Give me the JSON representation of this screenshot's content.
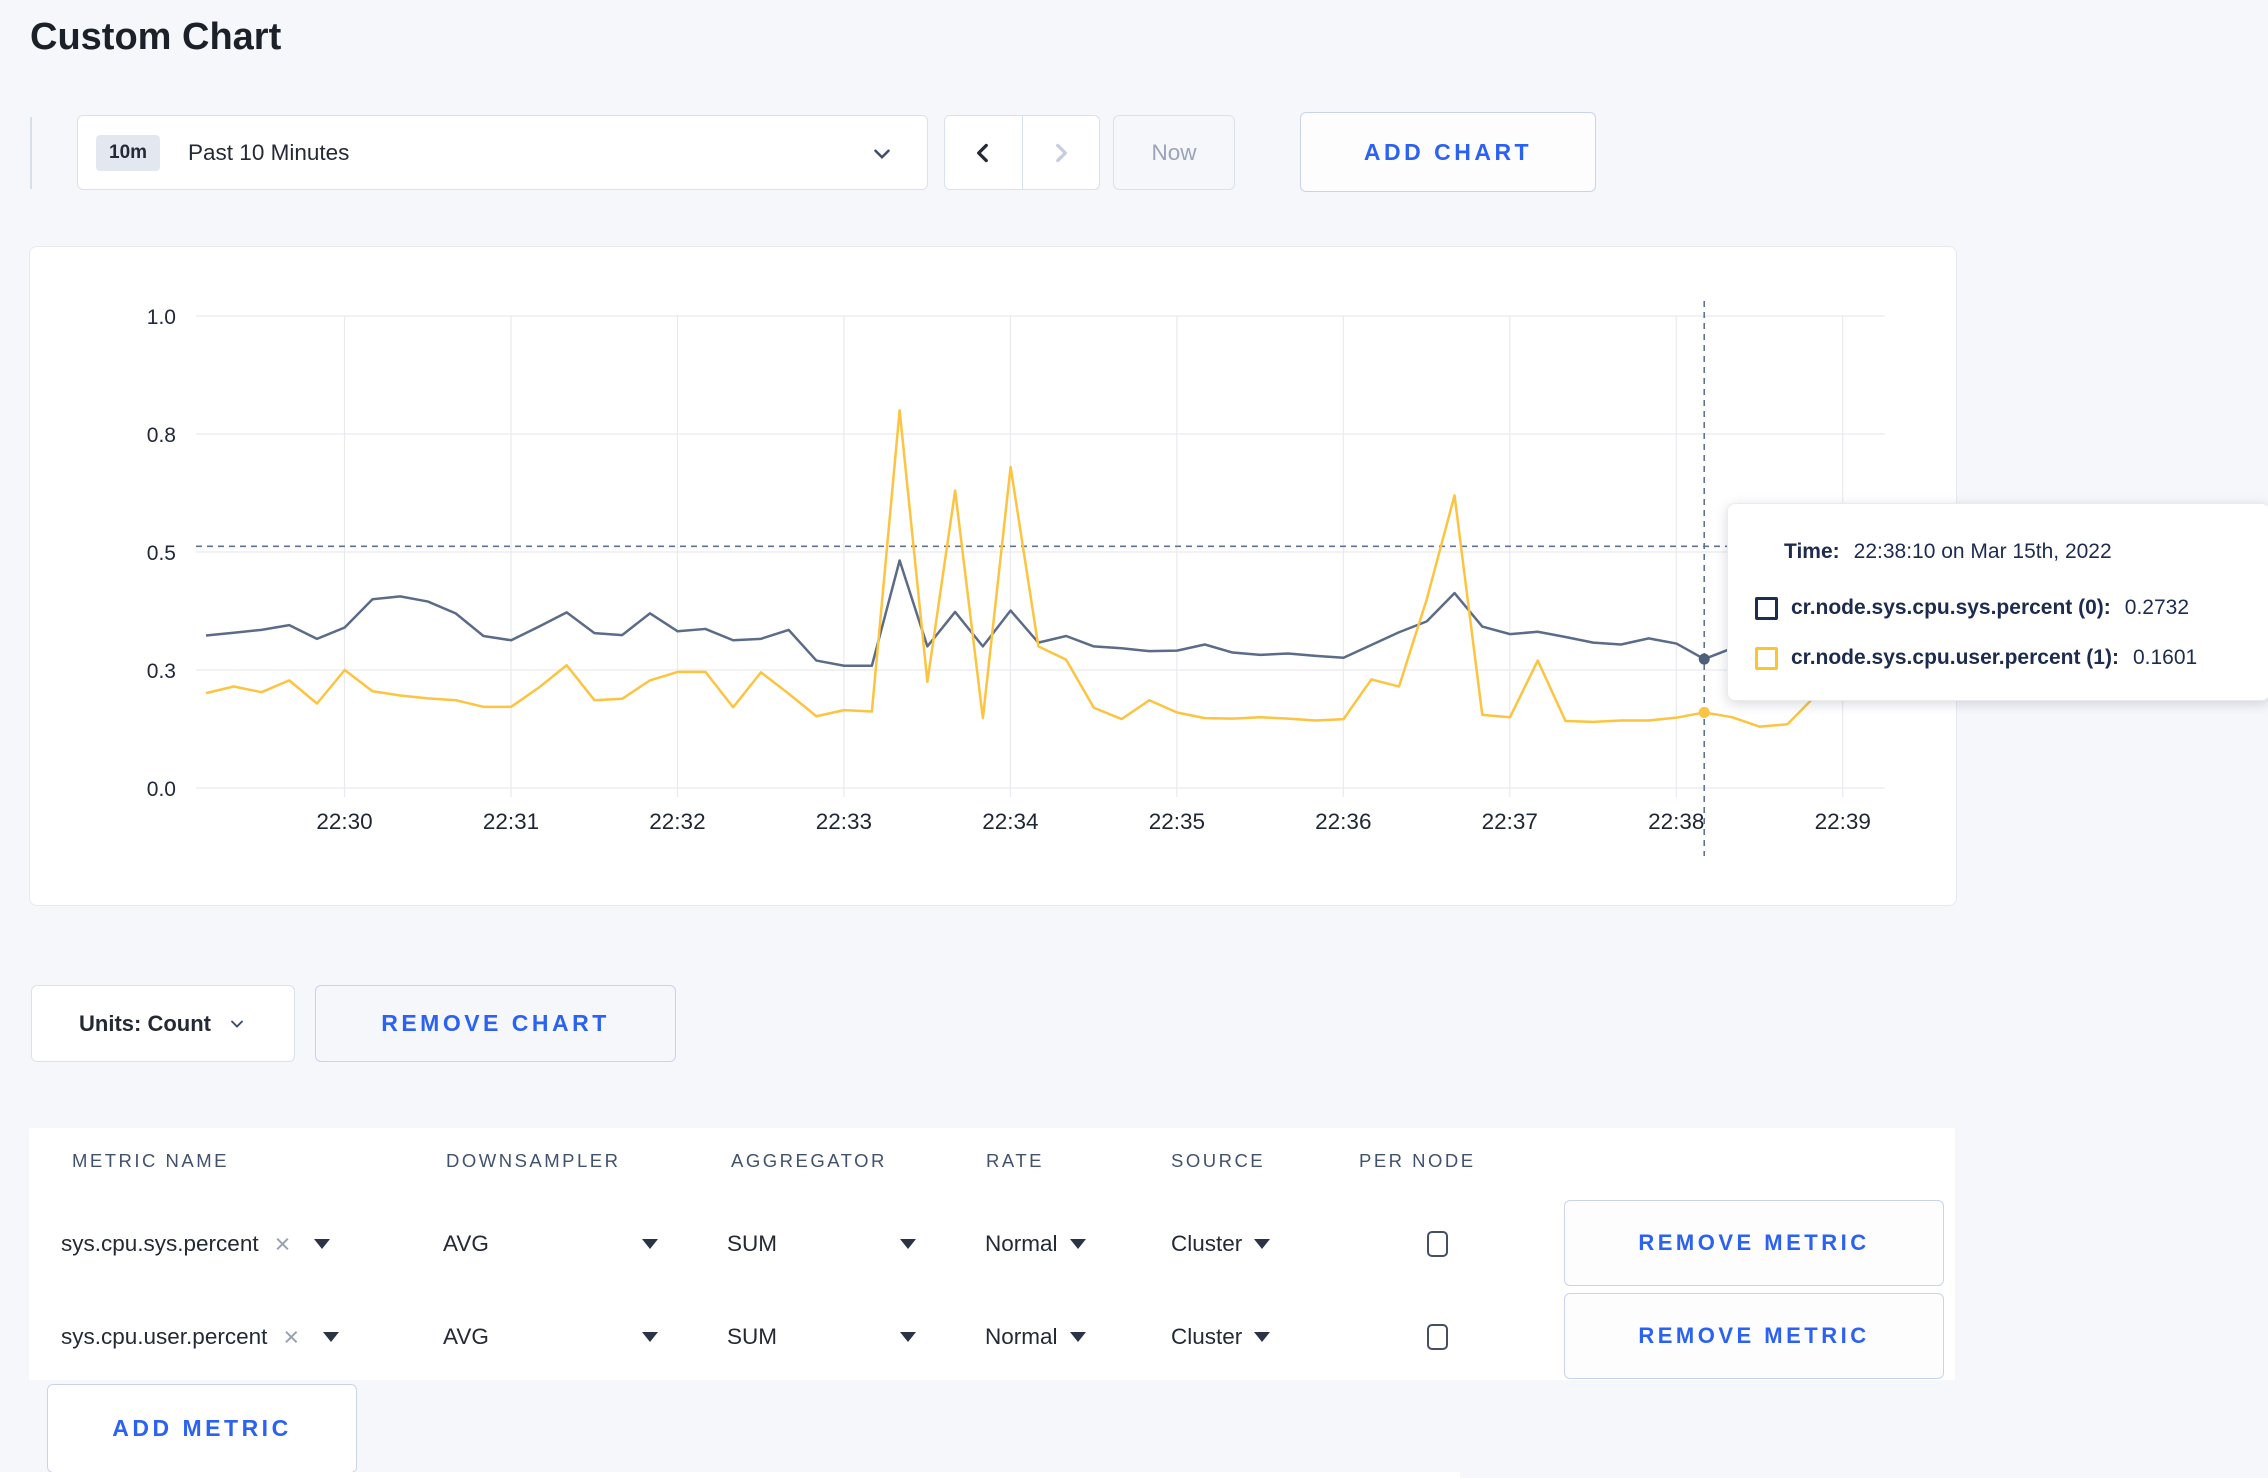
{
  "page": {
    "title": "Custom Chart"
  },
  "toolbar": {
    "time_range": {
      "badge": "10m",
      "label": "Past 10 Minutes"
    },
    "prev_label": "previous time window",
    "next_label": "next time window",
    "now_label": "Now",
    "add_chart_label": "ADD CHART"
  },
  "chart_data": {
    "type": "line",
    "title": "",
    "xlabel": "",
    "ylabel": "",
    "ylim": [
      0,
      1
    ],
    "grid": true,
    "legend_position": "tooltip",
    "x_ticks": [
      "22:30",
      "22:31",
      "22:32",
      "22:33",
      "22:34",
      "22:35",
      "22:36",
      "22:37",
      "22:38",
      "22:39"
    ],
    "y_ticks": [
      {
        "label": "1.0",
        "v": 1.0
      },
      {
        "label": "0.8",
        "v": 0.75
      },
      {
        "label": "0.5",
        "v": 0.5
      },
      {
        "label": "0.3",
        "v": 0.25
      },
      {
        "label": "0.0",
        "v": 0.0
      }
    ],
    "start_time": "22:29:10",
    "interval_seconds": 10,
    "threshold_value": 0.512,
    "crosshair": {
      "index": 54,
      "time": "22:38:10"
    },
    "series": [
      {
        "name": "cr.node.sys.cpu.sys.percent",
        "color": "#5b6b88",
        "dot_color": "#4e5e7b",
        "values": [
          0.323,
          0.329,
          0.335,
          0.345,
          0.316,
          0.34,
          0.4,
          0.406,
          0.395,
          0.37,
          0.322,
          0.313,
          0.342,
          0.372,
          0.328,
          0.324,
          0.37,
          0.332,
          0.337,
          0.313,
          0.316,
          0.335,
          0.27,
          0.259,
          0.259,
          0.482,
          0.3,
          0.373,
          0.3,
          0.376,
          0.308,
          0.322,
          0.3,
          0.296,
          0.29,
          0.291,
          0.304,
          0.287,
          0.282,
          0.285,
          0.28,
          0.276,
          0.303,
          0.33,
          0.353,
          0.413,
          0.342,
          0.326,
          0.331,
          0.32,
          0.308,
          0.304,
          0.317,
          0.306,
          0.2732,
          0.296,
          0.302,
          0.3,
          0.305,
          0.312,
          0.304
        ]
      },
      {
        "name": "cr.node.sys.cpu.user.percent",
        "color": "#fcc440",
        "dot_color": "#fcc440",
        "values": [
          0.201,
          0.215,
          0.203,
          0.228,
          0.179,
          0.25,
          0.205,
          0.196,
          0.19,
          0.186,
          0.172,
          0.172,
          0.213,
          0.26,
          0.186,
          0.189,
          0.228,
          0.246,
          0.246,
          0.171,
          0.245,
          0.2,
          0.152,
          0.165,
          0.162,
          0.8,
          0.225,
          0.63,
          0.148,
          0.68,
          0.3,
          0.272,
          0.17,
          0.146,
          0.186,
          0.16,
          0.148,
          0.147,
          0.15,
          0.147,
          0.143,
          0.146,
          0.23,
          0.215,
          0.4,
          0.62,
          0.155,
          0.15,
          0.27,
          0.142,
          0.14,
          0.143,
          0.143,
          0.149,
          0.1601,
          0.15,
          0.13,
          0.135,
          0.195,
          0.25,
          0.205
        ]
      }
    ]
  },
  "tooltip": {
    "time_label": "Time:",
    "time_value": "22:38:10 on Mar 15th, 2022",
    "rows": [
      {
        "label": "cr.node.sys.cpu.sys.percent (0):",
        "value": "0.2732",
        "color": "#1d2d52"
      },
      {
        "label": "cr.node.sys.cpu.user.percent (1):",
        "value": "0.1601",
        "color": "#ffc42d"
      }
    ]
  },
  "chart_controls": {
    "units_label": "Units: Count",
    "remove_chart_label": "REMOVE CHART"
  },
  "metrics_table": {
    "headers": [
      "METRIC NAME",
      "DOWNSAMPLER",
      "AGGREGATOR",
      "RATE",
      "SOURCE",
      "PER NODE"
    ],
    "rows": [
      {
        "metric": "sys.cpu.sys.percent",
        "downsampler": "AVG",
        "aggregator": "SUM",
        "rate": "Normal",
        "source": "Cluster",
        "per_node": false,
        "remove_label": "REMOVE METRIC"
      },
      {
        "metric": "sys.cpu.user.percent",
        "downsampler": "AVG",
        "aggregator": "SUM",
        "rate": "Normal",
        "source": "Cluster",
        "per_node": false,
        "remove_label": "REMOVE METRIC"
      }
    ],
    "add_metric_label": "ADD METRIC"
  }
}
